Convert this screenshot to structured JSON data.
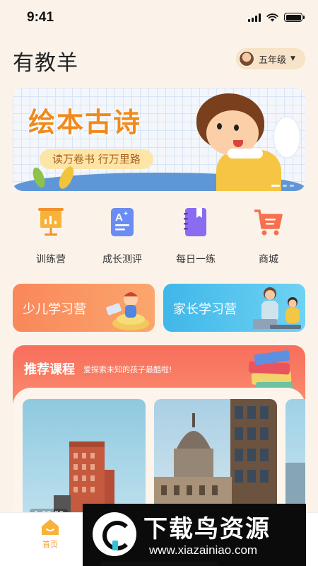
{
  "status_bar": {
    "time": "9:41"
  },
  "header": {
    "title": "有教羊",
    "grade": "五年级"
  },
  "banner": {
    "title": "绘本古诗",
    "subtitle": "读万卷书 行万里路"
  },
  "nav": [
    {
      "label": "训练营",
      "icon": "chalkboard-icon",
      "color": "#f5a623"
    },
    {
      "label": "成长测评",
      "icon": "test-doc-icon",
      "color": "#6b8cf2"
    },
    {
      "label": "每日一练",
      "icon": "notebook-icon",
      "color": "#8a6cf0"
    },
    {
      "label": "商城",
      "icon": "cart-icon",
      "color": "#f7714f"
    }
  ],
  "camps": [
    {
      "label": "少儿学习营"
    },
    {
      "label": "家长学习营"
    }
  ],
  "recommend": {
    "title": "推荐课程",
    "subtitle": "爱探索未知的孩子最酷啦!",
    "courses": [
      {
        "duration": "1:00:00"
      },
      {
        "duration": ""
      },
      {
        "duration": ""
      }
    ]
  },
  "tabbar": {
    "home": "首页"
  },
  "watermark": {
    "text": "下载鸟资源",
    "url": "www.xiazainiao.com"
  },
  "colors": {
    "accent": "#f59a2e",
    "background": "#fbf3ea"
  }
}
